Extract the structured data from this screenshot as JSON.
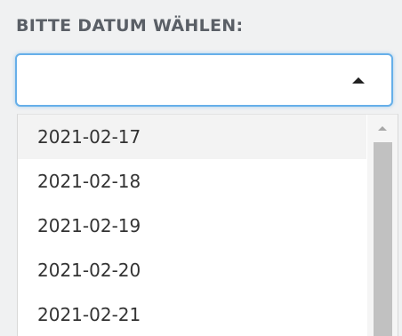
{
  "field": {
    "label": "BITTE DATUM WÄHLEN:",
    "selected_value": ""
  },
  "dropdown": {
    "options": [
      {
        "label": "2021-02-17",
        "highlighted": true
      },
      {
        "label": "2021-02-18",
        "highlighted": false
      },
      {
        "label": "2021-02-19",
        "highlighted": false
      },
      {
        "label": "2021-02-20",
        "highlighted": false
      },
      {
        "label": "2021-02-21",
        "highlighted": false
      }
    ]
  },
  "colors": {
    "focus_border": "#66afe9",
    "label_text": "#5a5f66",
    "option_text": "#333333",
    "highlight_bg": "#f3f3f3",
    "scroll_thumb": "#c1c1c1"
  },
  "icons": {
    "select_caret": "caret-up-icon",
    "scroll_up": "scroll-up-arrow-icon"
  }
}
